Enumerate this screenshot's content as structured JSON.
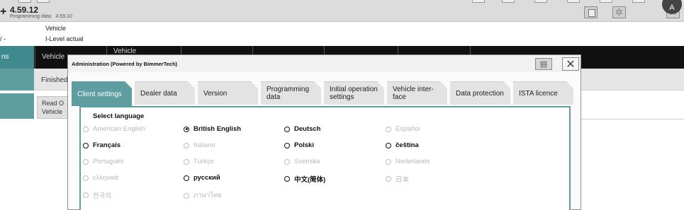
{
  "app": {
    "version": "4.59.12",
    "programming_label": "Programming data:",
    "programming_value": "4.59.10"
  },
  "vehicle": {
    "label": "Vehicle",
    "ilevel_label": "I-Level actual",
    "dash": "/ -"
  },
  "nav": {
    "left_label": "ns",
    "tabs": [
      "Vehicle",
      "Vehicle"
    ]
  },
  "subrow": {
    "status_text": "Finished",
    "button_label_line1": "Read O",
    "button_label_line2": "Vehicle"
  },
  "dialog": {
    "title": "Administration (Powered by BimmerTech)",
    "tabs": [
      {
        "label": "Client settings"
      },
      {
        "label": "Dealer data"
      },
      {
        "label": "Version"
      },
      {
        "label": "Programming data"
      },
      {
        "label": "Initial operation settings"
      },
      {
        "label": "Vehicle inter-face"
      },
      {
        "label": "Data protection"
      },
      {
        "label": "ISTA licence"
      }
    ],
    "select_language_label": "Select language",
    "languages": [
      {
        "label": "American English",
        "enabled": false,
        "selected": false
      },
      {
        "label": "British English",
        "enabled": true,
        "selected": true
      },
      {
        "label": "Deutsch",
        "enabled": true,
        "selected": false
      },
      {
        "label": "Español",
        "enabled": false,
        "selected": false
      },
      {
        "label": "Français",
        "enabled": true,
        "selected": false
      },
      {
        "label": "Italiano",
        "enabled": false,
        "selected": false
      },
      {
        "label": "Polski",
        "enabled": true,
        "selected": false
      },
      {
        "label": "čeština",
        "enabled": true,
        "selected": false
      },
      {
        "label": "Português",
        "enabled": false,
        "selected": false
      },
      {
        "label": "Türkçe",
        "enabled": false,
        "selected": false
      },
      {
        "label": "Svenska",
        "enabled": false,
        "selected": false
      },
      {
        "label": "Nederlands",
        "enabled": false,
        "selected": false
      },
      {
        "label": "ελληνικά",
        "enabled": false,
        "selected": false
      },
      {
        "label": "русский",
        "enabled": true,
        "selected": false
      },
      {
        "label": "中文(简体)",
        "enabled": true,
        "selected": false
      },
      {
        "label": "日本",
        "enabled": false,
        "selected": false
      },
      {
        "label": "한국의",
        "enabled": false,
        "selected": false
      },
      {
        "label": "ภาษาไทย",
        "enabled": false,
        "selected": false
      }
    ]
  },
  "colors": {
    "accent": "#5f9ea0",
    "navbar": "#111111"
  },
  "help_button_label": "A"
}
